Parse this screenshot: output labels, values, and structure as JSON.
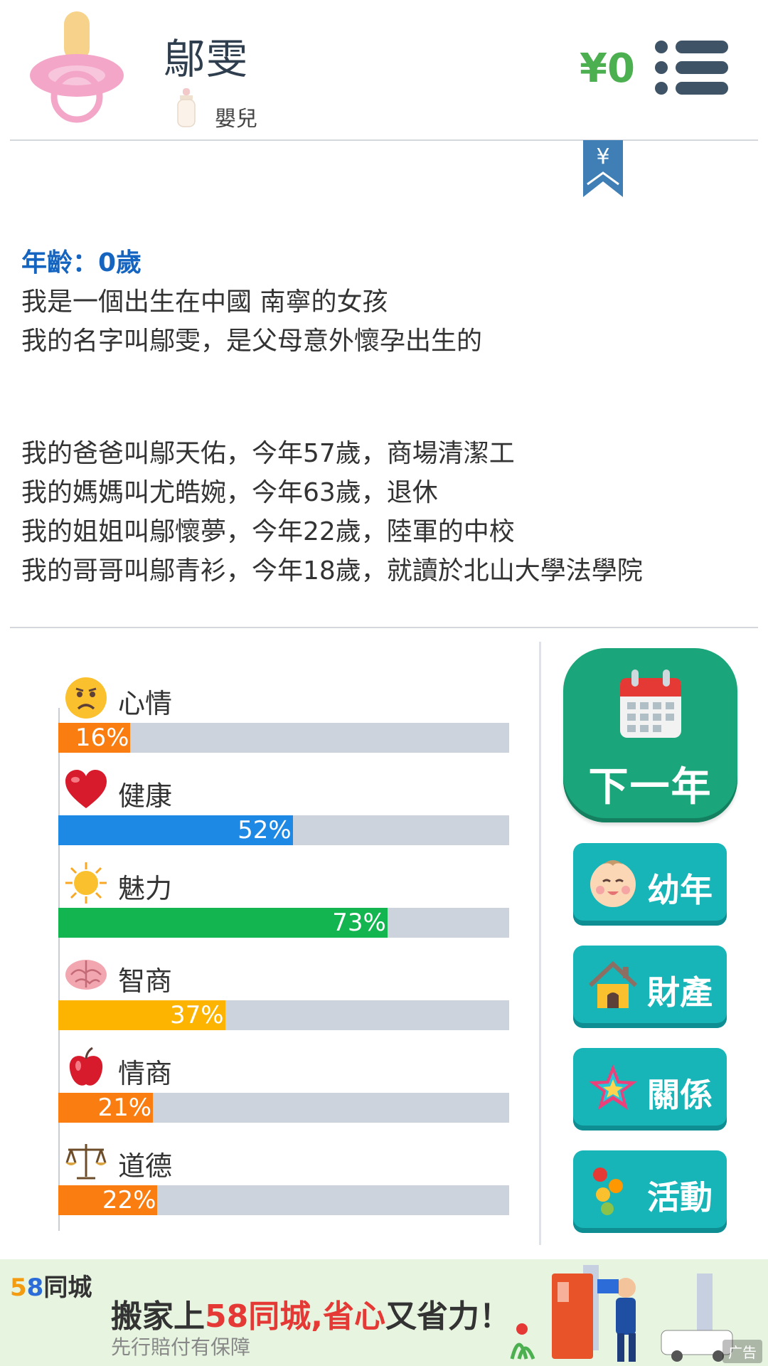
{
  "header": {
    "name": "鄔雯",
    "stage": "嬰兒",
    "money": "¥0",
    "bookmark_symbol": "¥"
  },
  "story": {
    "age": "年齡：0歲",
    "lines": [
      "我是一個出生在中國 南寧的女孩",
      "我的名字叫鄔雯，是父母意外懷孕出生的"
    ],
    "family": [
      "我的爸爸叫鄔天佑，今年57歲，商場清潔工",
      "我的媽媽叫尤皓婉，今年63歲，退休",
      "我的姐姐叫鄔懷夢，今年22歲，陸軍的中校",
      "我的哥哥叫鄔青衫，今年18歲，就讀於北山大學法學院"
    ]
  },
  "stats": [
    {
      "label": "心情",
      "value": 16,
      "text": "16%",
      "color": "#fa7d12",
      "icon": "sad-face-icon"
    },
    {
      "label": "健康",
      "value": 52,
      "text": "52%",
      "color": "#1e88e5",
      "icon": "heart-icon"
    },
    {
      "label": "魅力",
      "value": 73,
      "text": "73%",
      "color": "#12b54f",
      "icon": "sun-icon"
    },
    {
      "label": "智商",
      "value": 37,
      "text": "37%",
      "color": "#fcb400",
      "icon": "brain-icon"
    },
    {
      "label": "情商",
      "value": 21,
      "text": "21%",
      "color": "#fa7d12",
      "icon": "apple-icon"
    },
    {
      "label": "道德",
      "value": 22,
      "text": "22%",
      "color": "#fa7d12",
      "icon": "scales-icon"
    }
  ],
  "actions": {
    "next_year": "下一年",
    "childhood": "幼年",
    "property": "財產",
    "relations": "關係",
    "activities": "活動"
  },
  "ad": {
    "brand_num1": "5",
    "brand_num2": "8",
    "brand_text": "同城",
    "headline_a": "搬家上",
    "headline_b": "58同城,省心",
    "headline_c": "又省力！",
    "sub": "先行賠付有保障",
    "tag": "广告"
  },
  "colors": {
    "money": "#4caf50",
    "age": "#1565c0",
    "next_year_button": "#1aa57a",
    "side_button": "#17b5b8",
    "bar_track": "#ccd3dc"
  }
}
